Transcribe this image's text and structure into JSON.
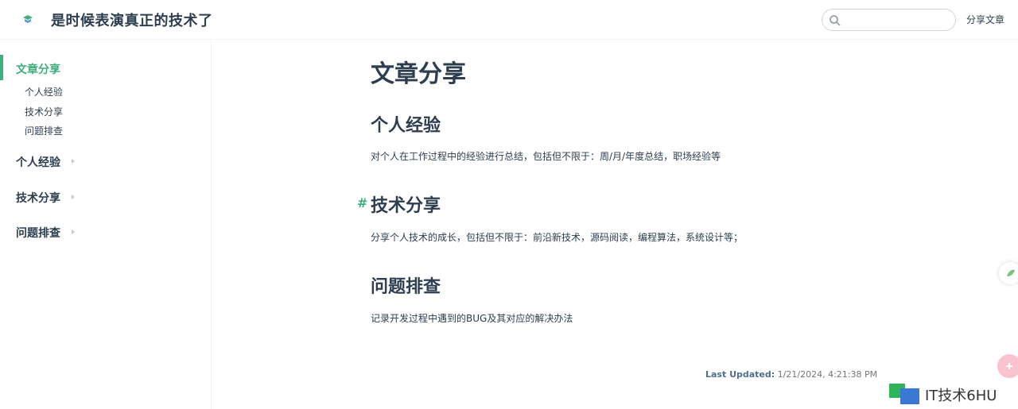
{
  "navbar": {
    "site_title": "是时候表演真正的技术了",
    "search": {
      "placeholder": "",
      "value": ""
    },
    "link_label": "分享文章"
  },
  "sidebar": {
    "active_group": "文章分享",
    "sub_items": [
      "个人经验",
      "技术分享",
      "问题排查"
    ],
    "groups": [
      "个人经验",
      "技术分享",
      "问题排查"
    ]
  },
  "content": {
    "title": "文章分享",
    "sections": [
      {
        "heading": "个人经验",
        "text": "对个人在工作过程中的经验进行总结，包括但不限于：周/月/年度总结，职场经验等"
      },
      {
        "heading": "技术分享",
        "text": "分享个人技术的成长，包括但不限于：前沿新技术，源码阅读，编程算法，系统设计等；"
      },
      {
        "heading": "问题排查",
        "text": "记录开发过程中遇到的BUG及其对应的解决办法"
      }
    ],
    "anchor_symbol": "#",
    "last_updated_label": "Last Updated:",
    "last_updated_value": "1/21/2024, 4:21:38 PM"
  },
  "watermark": {
    "text": "IT技术6HU"
  },
  "colors": {
    "accent": "#3eaf7c",
    "text": "#2c3e50"
  },
  "icons": [
    "logo-icon",
    "search-icon",
    "chevron-right-icon"
  ]
}
